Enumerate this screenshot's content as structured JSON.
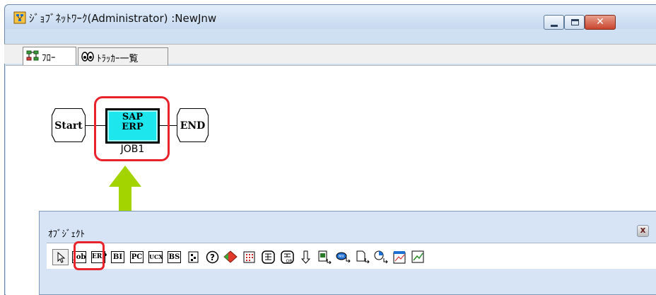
{
  "window": {
    "title": "ｼﾞｮﾌﾞﾈｯﾄﾜｰｸ(Administrator) :NewJnw",
    "controls": {
      "minimize": "minimize",
      "maximize": "maximize",
      "close": "✕"
    }
  },
  "tabs": [
    {
      "label": "ﾌﾛｰ",
      "icon": "flow-icon",
      "active": true
    },
    {
      "label": "ﾄﾗｯｶｰ一覧",
      "icon": "tracker-icon",
      "active": false
    }
  ],
  "flow": {
    "nodes": {
      "start": {
        "label": "Start"
      },
      "job": {
        "text_line1": "SAP",
        "text_line2": "ERP",
        "name": "JOB1",
        "fill": "#1de6ec"
      },
      "end": {
        "label": "END"
      }
    },
    "highlight_color": "#e8232b",
    "arrow_color": "#a4d400"
  },
  "object_panel": {
    "title": "ｵﾌﾞｼﾞｪｸﾄ",
    "close": "x",
    "tools": [
      {
        "name": "pointer-tool",
        "glyph": "⇱"
      },
      {
        "name": "job-tool",
        "label": "Job"
      },
      {
        "name": "erp-tool",
        "label": "ERP",
        "highlighted": true
      },
      {
        "name": "bi-tool",
        "label": "BI"
      },
      {
        "name": "pc-tool",
        "label": "PC"
      },
      {
        "name": "ucx-tool",
        "label": "UCX"
      },
      {
        "name": "bs-tool",
        "label": "BS"
      },
      {
        "name": "jobnet-tool",
        "glyph": "▦"
      },
      {
        "name": "condition-tool",
        "glyph": "?"
      },
      {
        "name": "event-tool",
        "glyph": "◆"
      },
      {
        "name": "calendar-tool",
        "glyph": "▦"
      },
      {
        "name": "and-tool",
        "glyph": "⊞"
      },
      {
        "name": "or-tool",
        "glyph": "⊟"
      },
      {
        "name": "down-arrow-tool",
        "glyph": "⇩"
      },
      {
        "name": "file-tool",
        "glyph": "▤"
      },
      {
        "name": "mail-tool",
        "glyph": "✉"
      },
      {
        "name": "document-tool",
        "glyph": "▭"
      },
      {
        "name": "timer-tool",
        "glyph": "◔"
      },
      {
        "name": "chart-tool",
        "glyph": "◪"
      },
      {
        "name": "chart2-tool",
        "glyph": "◩"
      }
    ]
  }
}
